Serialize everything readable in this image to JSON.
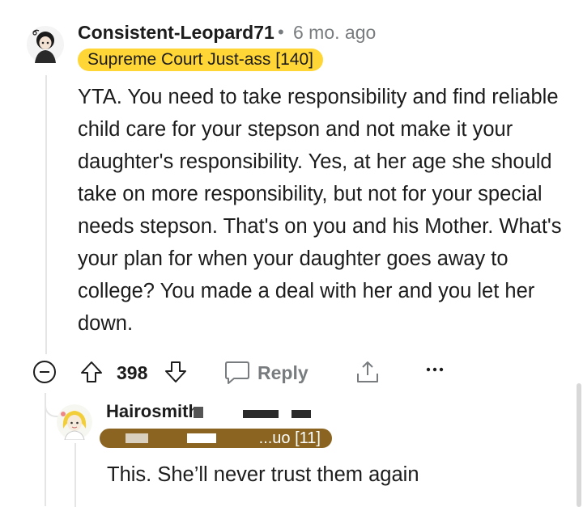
{
  "comment": {
    "username": "Consistent-Leopard71",
    "separator": "•",
    "time_ago": "6 mo. ago",
    "flair": "Supreme Court Just-ass [140]",
    "body": "YTA. You need to take responsibility and find reliable child care for your stepson and not make it your daughter's responsibility. Yes, at her age she should take on more responsibility, but not for your special needs stepson. That's on you and his Mother. What's your plan for when your daughter goes away to college? You made a deal with her and you let her down.",
    "score": "398",
    "reply_label": "Reply",
    "icons": {
      "collapse": "collapse-minus-icon",
      "upvote": "upvote-arrow-icon",
      "downvote": "downvote-arrow-icon",
      "reply": "speech-bubble-icon",
      "share": "share-upload-icon",
      "more": "more-dots-icon"
    }
  },
  "reply_comment": {
    "username": "Hairosmith",
    "flair_visible": "...uo [11]",
    "body": "This. She’ll never trust them again"
  },
  "colors": {
    "flair_bg": "#ffd635",
    "meta_gray": "#787c7e",
    "text": "#1c1c1c",
    "redacted_flair": "#8a6420"
  }
}
